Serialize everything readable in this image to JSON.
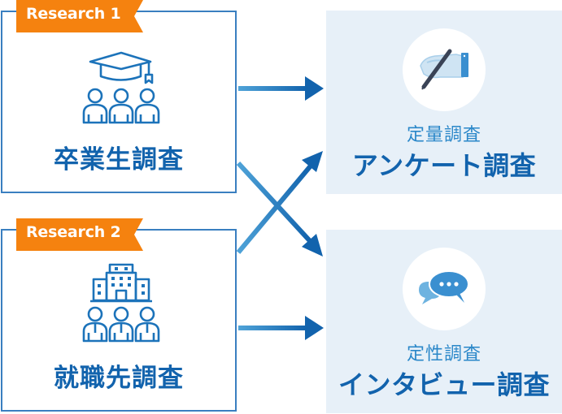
{
  "sources": [
    {
      "tag": "Research 1",
      "title": "卒業生調査",
      "icon": "graduates-icon"
    },
    {
      "tag": "Research 2",
      "title": "就職先調査",
      "icon": "employers-icon"
    }
  ],
  "methods": [
    {
      "subtitle": "定量調査",
      "title": "アンケート調査",
      "icon": "survey-writing-icon"
    },
    {
      "subtitle": "定性調査",
      "title": "インタビュー調査",
      "icon": "speech-bubbles-icon"
    }
  ],
  "connections": [
    {
      "from": "Research 1",
      "to": "アンケート調査"
    },
    {
      "from": "Research 1",
      "to": "インタビュー調査"
    },
    {
      "from": "Research 2",
      "to": "アンケート調査"
    },
    {
      "from": "Research 2",
      "to": "インタビュー調査"
    }
  ],
  "colors": {
    "tag": "#f5820f",
    "primary": "#1263ad",
    "accent": "#2a87c9",
    "method_bg": "#e7f0f8",
    "border": "#3a7fc0"
  }
}
